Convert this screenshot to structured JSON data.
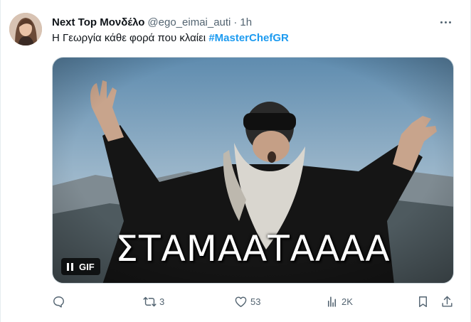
{
  "tweet": {
    "author_name": "Next Top Μονδέλο",
    "author_handle": "@ego_eimai_auti",
    "separator": "·",
    "time": "1h",
    "text_prefix": "Η Γεωργία κάθε φορά που κλαίει ",
    "hashtag": "#MasterChefGR"
  },
  "media": {
    "caption": "ΣΤΑΜΑΑΤΑΑΑΑ",
    "badge_label": "GIF"
  },
  "actions": {
    "replies": "",
    "retweets": "3",
    "likes": "53",
    "views": "2K"
  },
  "colors": {
    "accent": "#1d9bf0",
    "muted": "#536471",
    "text": "#0f1419"
  }
}
